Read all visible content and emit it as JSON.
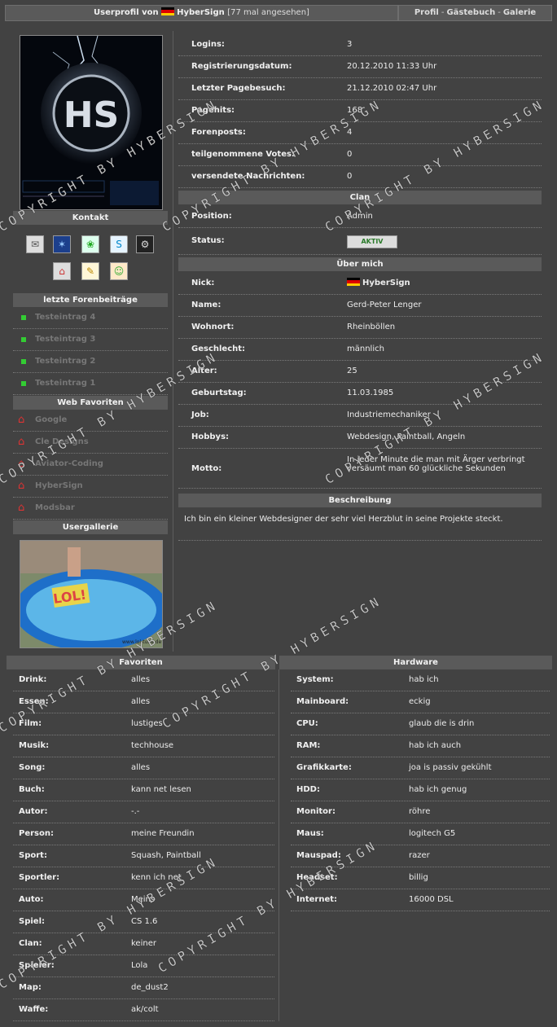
{
  "header": {
    "title_prefix": "Userprofil von",
    "username": "HyberSign",
    "views": "[77 mal angesehen]",
    "nav": [
      "Profil",
      "Gästebuch",
      "Galerie"
    ]
  },
  "left": {
    "kontakt_title": "Kontakt",
    "contact_icons": [
      "mail-icon",
      "msn-icon",
      "icq-icon",
      "skype-icon",
      "steam-icon",
      "homepage-icon",
      "notes-icon",
      "add-buddy-icon"
    ],
    "forum_title": "letzte Forenbeiträge",
    "forum_posts": [
      "Testeintrag 4",
      "Testeintrag 3",
      "Testeintrag 2",
      "Testeintrag 1"
    ],
    "favorites_title": "Web Favoriten",
    "web_favorites": [
      "Google",
      "Cle Designs",
      "Aviator-Coding",
      "HyberSign",
      "Modsbar"
    ],
    "gallery_title": "Usergallerie",
    "gallery_text": "LOL!",
    "gallery_url": "www.lol-tube.de"
  },
  "stats": [
    {
      "k": "Logins:",
      "v": "3"
    },
    {
      "k": "Registrierungsdatum:",
      "v": "20.12.2010 11:33 Uhr"
    },
    {
      "k": "Letzter Pagebesuch:",
      "v": "21.12.2010 02:47 Uhr"
    },
    {
      "k": "Pagehits:",
      "v": "168"
    },
    {
      "k": "Forenposts:",
      "v": "4"
    },
    {
      "k": "teilgenommene Votes:",
      "v": "0"
    },
    {
      "k": "versendete Nachrichten:",
      "v": "0"
    }
  ],
  "clan": {
    "title": "Clan",
    "position_label": "Position:",
    "position": "Admin",
    "status_label": "Status:",
    "status_badge": "AKTIV"
  },
  "about": {
    "title": "Über mich",
    "rows": [
      {
        "k": "Nick:",
        "v": "HyberSign"
      },
      {
        "k": "Name:",
        "v": "Gerd-Peter Lenger"
      },
      {
        "k": "Wohnort:",
        "v": "Rheinböllen"
      },
      {
        "k": "Geschlecht:",
        "v": "männlich"
      },
      {
        "k": "Alter:",
        "v": "25"
      },
      {
        "k": "Geburtstag:",
        "v": "11.03.1985"
      },
      {
        "k": "Job:",
        "v": "Industriemechaniker"
      },
      {
        "k": "Hobbys:",
        "v": "Webdesign, Paintball, Angeln"
      }
    ],
    "motto_label": "Motto:",
    "motto": "In jeder Minute die man mit Ärger verbringt versäumt man 60 glückliche Sekunden"
  },
  "beschreibung": {
    "title": "Beschreibung",
    "text": "Ich bin ein kleiner Webdesigner der sehr viel Herzblut in seine Projekte steckt."
  },
  "favoriten": {
    "title": "Favoriten",
    "rows": [
      {
        "k": "Drink:",
        "v": "alles"
      },
      {
        "k": "Essen:",
        "v": "alles"
      },
      {
        "k": "Film:",
        "v": "lustiges"
      },
      {
        "k": "Musik:",
        "v": "techhouse"
      },
      {
        "k": "Song:",
        "v": "alles"
      },
      {
        "k": "Buch:",
        "v": "kann net lesen"
      },
      {
        "k": "Autor:",
        "v": "-.-"
      },
      {
        "k": "Person:",
        "v": "meine Freundin"
      },
      {
        "k": "Sport:",
        "v": "Squash, Paintball"
      },
      {
        "k": "Sportler:",
        "v": "kenn ich net"
      },
      {
        "k": "Auto:",
        "v": "Meins"
      },
      {
        "k": "Spiel:",
        "v": "CS 1.6"
      },
      {
        "k": "Clan:",
        "v": "keiner"
      },
      {
        "k": "Spieler:",
        "v": "Lola"
      },
      {
        "k": "Map:",
        "v": "de_dust2"
      },
      {
        "k": "Waffe:",
        "v": "ak/colt"
      }
    ]
  },
  "hardware": {
    "title": "Hardware",
    "rows": [
      {
        "k": "System:",
        "v": "hab ich"
      },
      {
        "k": "Mainboard:",
        "v": "eckig"
      },
      {
        "k": "CPU:",
        "v": "glaub die is drin"
      },
      {
        "k": "RAM:",
        "v": "hab ich auch"
      },
      {
        "k": "Grafikkarte:",
        "v": "joa is passiv gekühlt"
      },
      {
        "k": "HDD:",
        "v": "hab ich genug"
      },
      {
        "k": "Monitor:",
        "v": "röhre"
      },
      {
        "k": "Maus:",
        "v": "logitech G5"
      },
      {
        "k": "Mauspad:",
        "v": "razer"
      },
      {
        "k": "Headset:",
        "v": "billig"
      },
      {
        "k": "Internet:",
        "v": "16000 DSL"
      }
    ]
  },
  "watermark": "COPYRIGHT BY HYBERSIGN",
  "colors": {
    "background": "#424242",
    "section": "#5a5a5a",
    "bullet_green": "#33cc33",
    "accent_red": "#dd3333"
  }
}
